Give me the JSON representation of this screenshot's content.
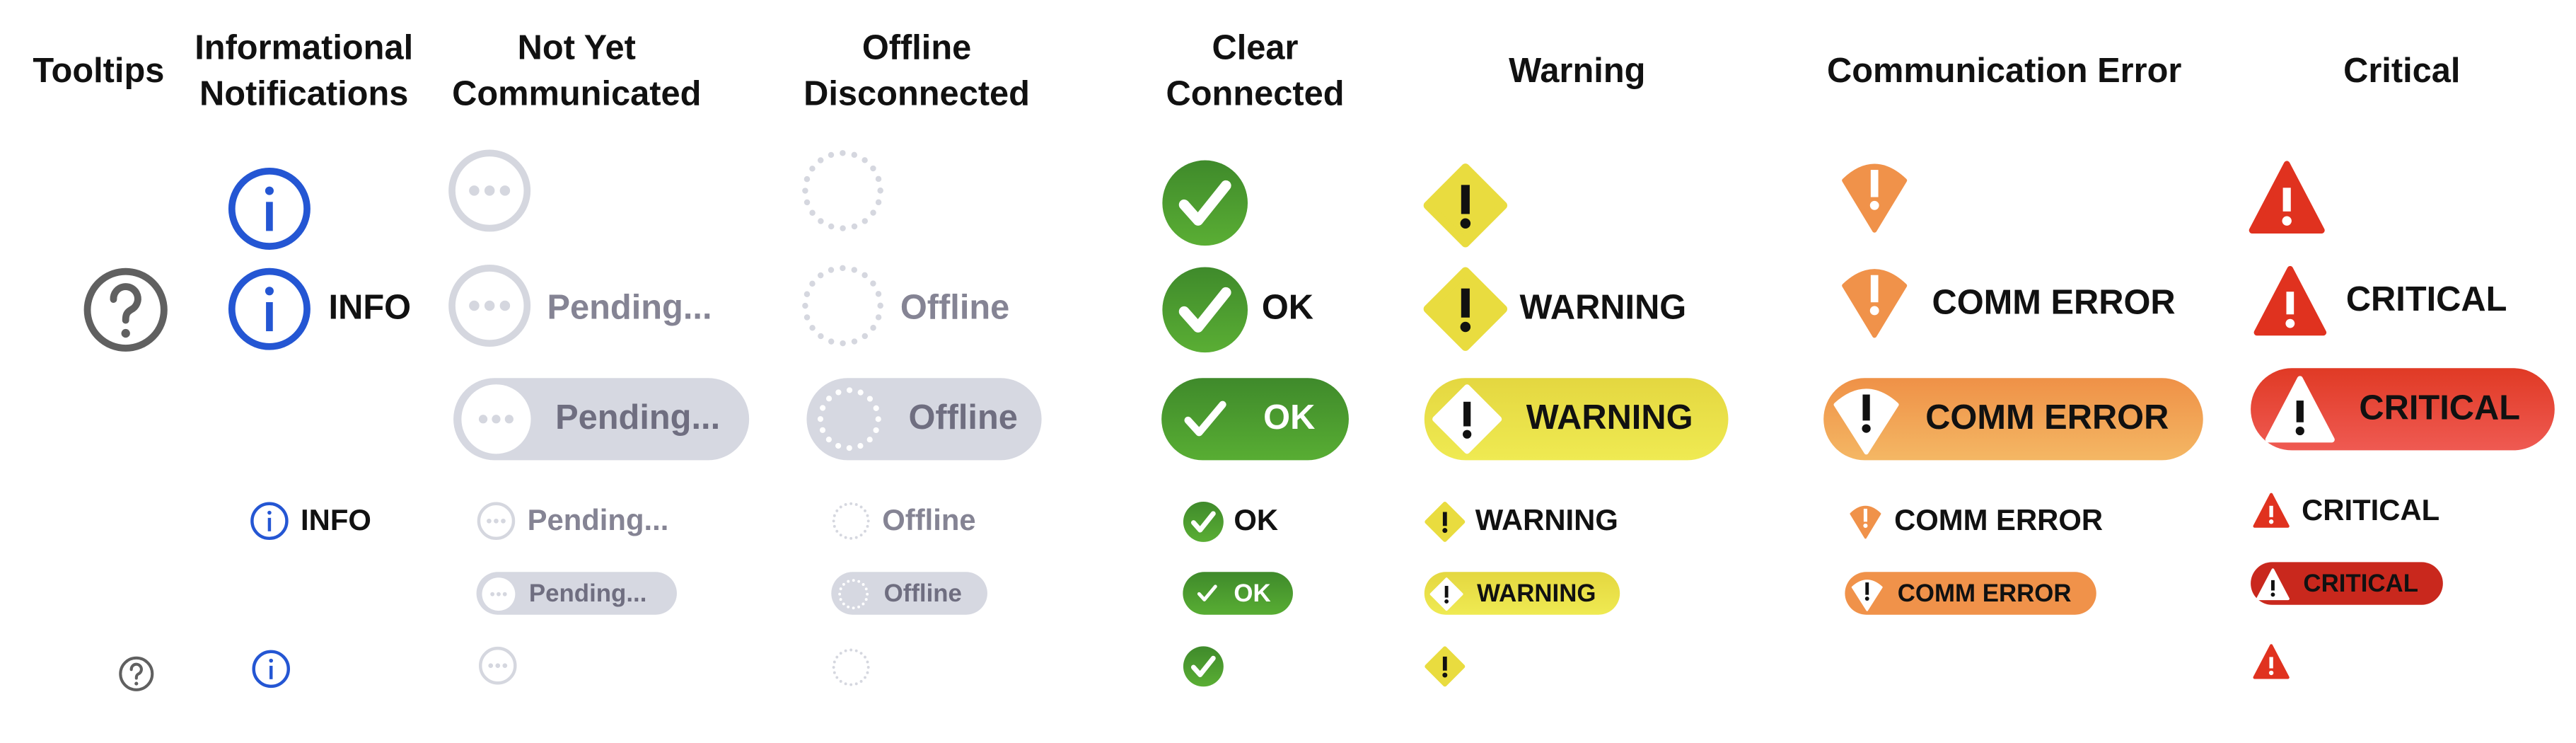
{
  "headers": {
    "tooltips": "Tooltips",
    "informational": [
      "Informational",
      "Notifications"
    ],
    "not_yet": [
      "Not Yet",
      "Communicated"
    ],
    "offline": [
      "Offline",
      "Disconnected"
    ],
    "clear": [
      "Clear",
      "Connected"
    ],
    "warning": "Warning",
    "comm_error": "Communication Error",
    "critical": "Critical"
  },
  "labels": {
    "info": "INFO",
    "pending": "Pending...",
    "offline": "Offline",
    "ok": "OK",
    "warning": "WARNING",
    "comm_error": "COMM ERROR",
    "critical": "CRITICAL"
  },
  "icons": [
    "question-icon",
    "info-icon",
    "pending-icon",
    "offline-icon",
    "check-icon",
    "warning-diamond-icon",
    "comm-error-icon",
    "critical-triangle-icon"
  ],
  "colors": {
    "tooltip": "#606060",
    "info": "#2456d3",
    "pending": "#d5d7df",
    "ok": "#4b9c2f",
    "warning": "#e9dc3f",
    "comm_error": "#f0924a",
    "critical": "#e0321f"
  }
}
